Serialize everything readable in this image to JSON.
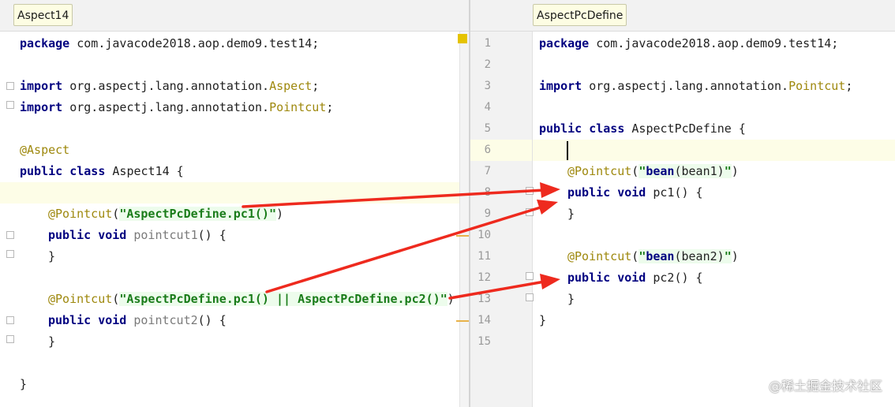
{
  "left": {
    "tab_label": "Aspect14",
    "lines": {
      "l1": {
        "kw": "package",
        "rest": " com.javacode2018.aop.demo9.test14;"
      },
      "l3": {
        "kw": "import",
        "rest": " org.aspectj.lang.annotation.",
        "cls": "Aspect",
        "end": ";"
      },
      "l4": {
        "kw": "import",
        "rest": " org.aspectj.lang.annotation.",
        "cls": "Pointcut",
        "end": ";"
      },
      "l6": {
        "ann": "@Aspect"
      },
      "l7": {
        "kw": "public class",
        "rest": " Aspect14 {"
      },
      "l9": {
        "ann": "@Pointcut",
        "open": "(",
        "str": "\"AspectPcDefine.pc1()\"",
        "close": ")"
      },
      "l10": {
        "kw": "public void",
        "method": " pointcut1",
        "rest": "() {"
      },
      "l11": {
        "rest": "}"
      },
      "l13": {
        "ann": "@Pointcut",
        "open": "(",
        "str": "\"AspectPcDefine.pc1() || AspectPcDefine.pc2()\"",
        "close": ")"
      },
      "l14": {
        "kw": "public void",
        "method": " pointcut2",
        "rest": "() {"
      },
      "l15": {
        "rest": "}"
      },
      "l17": {
        "rest": "}"
      }
    }
  },
  "right": {
    "tab_label": "AspectPcDefine",
    "line_numbers": [
      "1",
      "2",
      "3",
      "4",
      "5",
      "6",
      "7",
      "8",
      "9",
      "10",
      "11",
      "12",
      "13",
      "14",
      "15"
    ],
    "lines": {
      "r1": {
        "kw": "package",
        "rest": " com.javacode2018.aop.demo9.test14;"
      },
      "r3": {
        "kw": "import",
        "rest": " org.aspectj.lang.annotation.",
        "cls": "Pointcut",
        "end": ";"
      },
      "r5": {
        "kw": "public class",
        "rest": " AspectPcDefine {"
      },
      "r7": {
        "ann": "@Pointcut",
        "open": "(",
        "q1": "\"",
        "kw2": "bean",
        "arg": "(bean1)",
        "q2": "\"",
        "close": ")"
      },
      "r8": {
        "kw": "public void",
        "rest": " pc1() {"
      },
      "r9": {
        "rest": "}"
      },
      "r11": {
        "ann": "@Pointcut",
        "open": "(",
        "q1": "\"",
        "kw2": "bean",
        "arg": "(bean2)",
        "q2": "\"",
        "close": ")"
      },
      "r12": {
        "kw": "public void",
        "rest": " pc2() {"
      },
      "r13": {
        "rest": "}"
      },
      "r14": {
        "rest": "}"
      }
    }
  },
  "watermark": "@稀土掘金技术社区",
  "colors": {
    "keyword": "#000080",
    "annotation": "#9e880d",
    "string": "#1a7c1a",
    "arrow": "#ee2a1e",
    "current_line": "#fdfde7"
  }
}
